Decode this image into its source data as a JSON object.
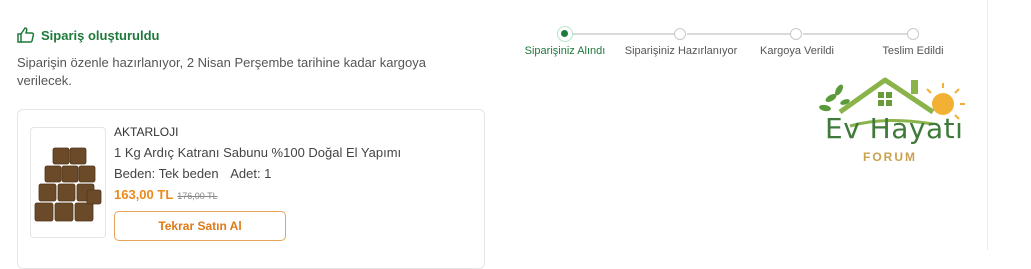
{
  "order": {
    "status_title": "Sipariş oluşturuldu",
    "status_desc": "Siparişin özenle hazırlanıyor, 2 Nisan Perşembe tarihine kadar kargoya verilecek."
  },
  "stepper": {
    "steps": [
      {
        "label": "Siparişiniz Alındı",
        "state": "active"
      },
      {
        "label": "Siparişiniz Hazırlanıyor",
        "state": "pending"
      },
      {
        "label": "Kargoya Verildi",
        "state": "pending"
      },
      {
        "label": "Teslim Edildi",
        "state": "pending"
      }
    ]
  },
  "product": {
    "seller": "AKTARLOJI",
    "name": "1 Kg Ardıç Katranı Sabunu %100 Doğal El Yapımı",
    "size": "Beden: Tek beden",
    "quantity": "Adet: 1",
    "price": "163,00 TL",
    "old_price": "176,00 TL",
    "rebuy_label": "Tekrar Satın Al"
  },
  "watermark": {
    "title": "Ev Hayatı",
    "subtitle": "FORUM"
  },
  "colors": {
    "brand_green": "#1e7a3a",
    "accent_orange": "#e07a16"
  },
  "icons": {
    "status": "thumbs-up-icon"
  }
}
